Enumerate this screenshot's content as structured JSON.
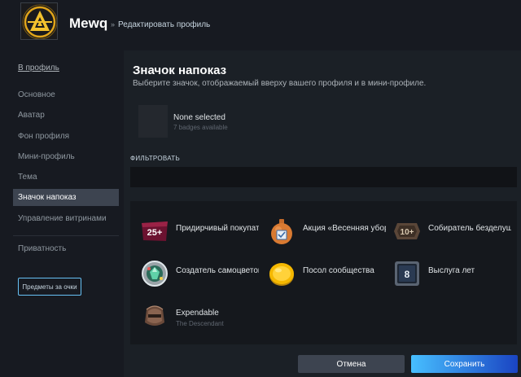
{
  "header": {
    "username": "Mewq",
    "breadcrumb_separator": "»",
    "breadcrumb": "Редактировать профиль"
  },
  "sidebar": {
    "back_link": "В профиль",
    "items": [
      {
        "label": "Основное"
      },
      {
        "label": "Аватар"
      },
      {
        "label": "Фон профиля"
      },
      {
        "label": "Мини-профиль"
      },
      {
        "label": "Тема"
      },
      {
        "label": "Значок напоказ"
      },
      {
        "label": "Управление витринами"
      },
      {
        "label": "Приватность"
      }
    ],
    "active_index": 5,
    "points_button": "Предметы за очки"
  },
  "main": {
    "title": "Значок напоказ",
    "subtitle": "Выберите значок, отображаемый вверху вашего профиля и в мини-профиле.",
    "current": {
      "name": "None selected",
      "count": "7 badges available"
    },
    "filter_label": "ФИЛЬТРОВАТЬ",
    "filter_value": ""
  },
  "badges": [
    {
      "name": "Придирчивый покупатель",
      "icon": "level-25-badge-icon"
    },
    {
      "name": "Акция «Весенняя уборка»",
      "icon": "spring-cleaning-badge-icon"
    },
    {
      "name": "Собиратель безделушек",
      "icon": "level-10-badge-icon"
    },
    {
      "name": "Создатель самоцветов",
      "icon": "gem-badge-icon"
    },
    {
      "name": "Посол сообщества",
      "icon": "gold-coin-badge-icon"
    },
    {
      "name": "Выслуга лет",
      "icon": "years-of-service-badge-icon",
      "level": "8"
    },
    {
      "name": "Expendable",
      "sub": "The Descendant",
      "icon": "helmet-badge-icon"
    }
  ],
  "badge_level_25": "25+",
  "badge_level_10": "10+",
  "footer": {
    "cancel_label": "Отмена",
    "save_label": "Сохранить"
  },
  "colors": {
    "accent": "#47bfff",
    "active_nav": "#3d4450",
    "background": "#1b2026"
  }
}
